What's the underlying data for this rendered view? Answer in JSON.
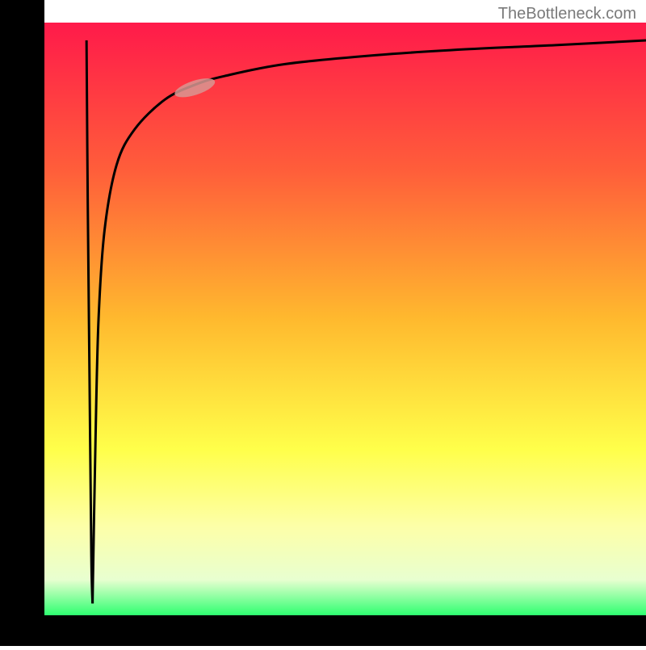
{
  "watermark": "TheBottleneck.com",
  "chart_data": {
    "type": "line",
    "title": "",
    "xlabel": "",
    "ylabel": "",
    "xlim": [
      0,
      100
    ],
    "ylim": [
      0,
      100
    ],
    "background": {
      "type": "vertical-gradient",
      "stops": [
        {
          "position": 0,
          "color": "#ff1a4a"
        },
        {
          "position": 25,
          "color": "#ff5e3a"
        },
        {
          "position": 50,
          "color": "#ffb92e"
        },
        {
          "position": 72,
          "color": "#ffff4a"
        },
        {
          "position": 85,
          "color": "#fdffa8"
        },
        {
          "position": 94,
          "color": "#e8ffd0"
        },
        {
          "position": 100,
          "color": "#2eff70"
        }
      ]
    },
    "axes": {
      "color": "#000000",
      "left_thickness": 55,
      "bottom_thickness": 38
    },
    "series": [
      {
        "name": "curve-down",
        "type": "line",
        "color": "#000000",
        "x": [
          7,
          7.2,
          7.5,
          7.8,
          8
        ],
        "y": [
          97,
          70,
          40,
          10,
          2
        ]
      },
      {
        "name": "curve-up",
        "type": "line",
        "color": "#000000",
        "x": [
          8,
          8.5,
          9,
          10,
          12,
          15,
          20,
          25,
          30,
          40,
          55,
          70,
          85,
          100
        ],
        "y": [
          2,
          30,
          50,
          65,
          76,
          82,
          87,
          89.5,
          91,
          93,
          94.5,
          95.5,
          96.2,
          97
        ]
      }
    ],
    "marker": {
      "description": "pink-oval-marker",
      "cx": 25,
      "cy": 89,
      "rx": 3.5,
      "ry": 1.2,
      "rotation": -18,
      "fill": "#d89792",
      "opacity": 0.85
    }
  }
}
